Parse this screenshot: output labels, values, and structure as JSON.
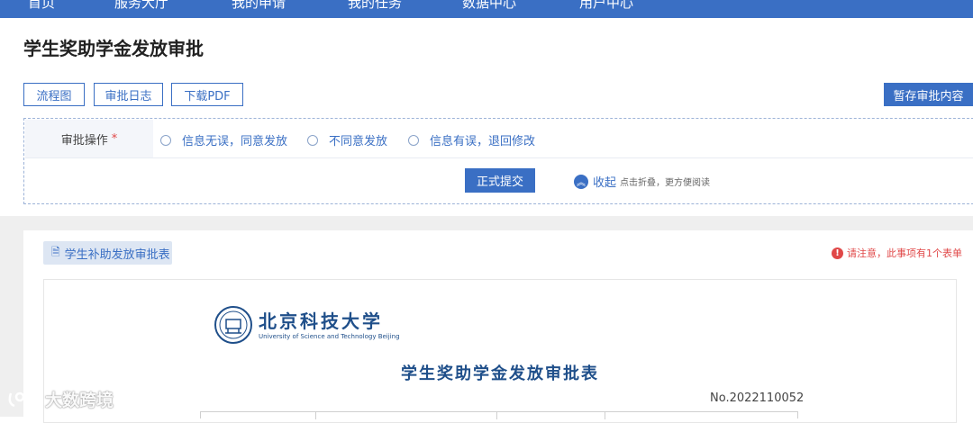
{
  "nav": {
    "items": [
      "首页",
      "服务大厅",
      "我的申请",
      "我的任务",
      "数据中心",
      "用户中心"
    ]
  },
  "page": {
    "title": "学生奖助学金发放审批"
  },
  "toolbar": {
    "flowchart": "流程图",
    "log": "审批日志",
    "download": "下载PDF",
    "save_draft": "暂存审批内容"
  },
  "approval": {
    "label": "审批操作",
    "required_mark": "*",
    "options": [
      "信息无误，同意发放",
      "不同意发放",
      "信息有误，退回修改"
    ],
    "submit": "正式提交",
    "collapse": "收起",
    "collapse_hint": "点击折叠，更方便阅读"
  },
  "form_section": {
    "chip": "学生补助发放审批表",
    "notice": "请注意，此事项有1个表单"
  },
  "document": {
    "university_cn": "北京科技大学",
    "university_en": "University of Science and Technology Beijing",
    "title": "学生奖助学金发放审批表",
    "serial": "No.2022110052"
  },
  "watermark": "大数跨境",
  "colors": {
    "primary": "#3a6fc4",
    "danger": "#e04848",
    "doc_blue": "#1f4f8a"
  }
}
